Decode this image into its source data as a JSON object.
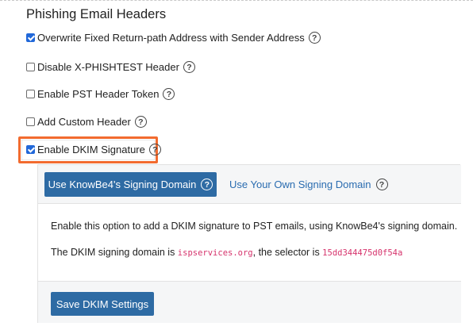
{
  "section_title": "Phishing Email Headers",
  "options": [
    {
      "label": "Overwrite Fixed Return-path Address with Sender Address",
      "checked": true
    },
    {
      "label": "Disable X-PHISHTEST Header",
      "checked": false
    },
    {
      "label": "Enable PST Header Token",
      "checked": false
    },
    {
      "label": "Add Custom Header",
      "checked": false
    },
    {
      "label": "Enable DKIM Signature",
      "checked": true
    }
  ],
  "help_icon_glyph": "?",
  "dkim_panel": {
    "tabs": {
      "active_label": "Use KnowBe4's Signing Domain",
      "other_label": "Use Your Own Signing Domain"
    },
    "description": "Enable this option to add a DKIM signature to PST emails, using KnowBe4's signing domain.",
    "domain_prefix": "The DKIM signing domain is ",
    "domain_value": "ispservices.org",
    "selector_prefix": ", the selector is ",
    "selector_value": "15dd344475d0f54a",
    "save_label": "Save DKIM Settings"
  },
  "colors": {
    "primary": "#2e6ba4",
    "link": "#2a6cb0",
    "highlight": "#f26b2f",
    "code": "#d6336c",
    "checkbox_checked": "#2168d9"
  }
}
